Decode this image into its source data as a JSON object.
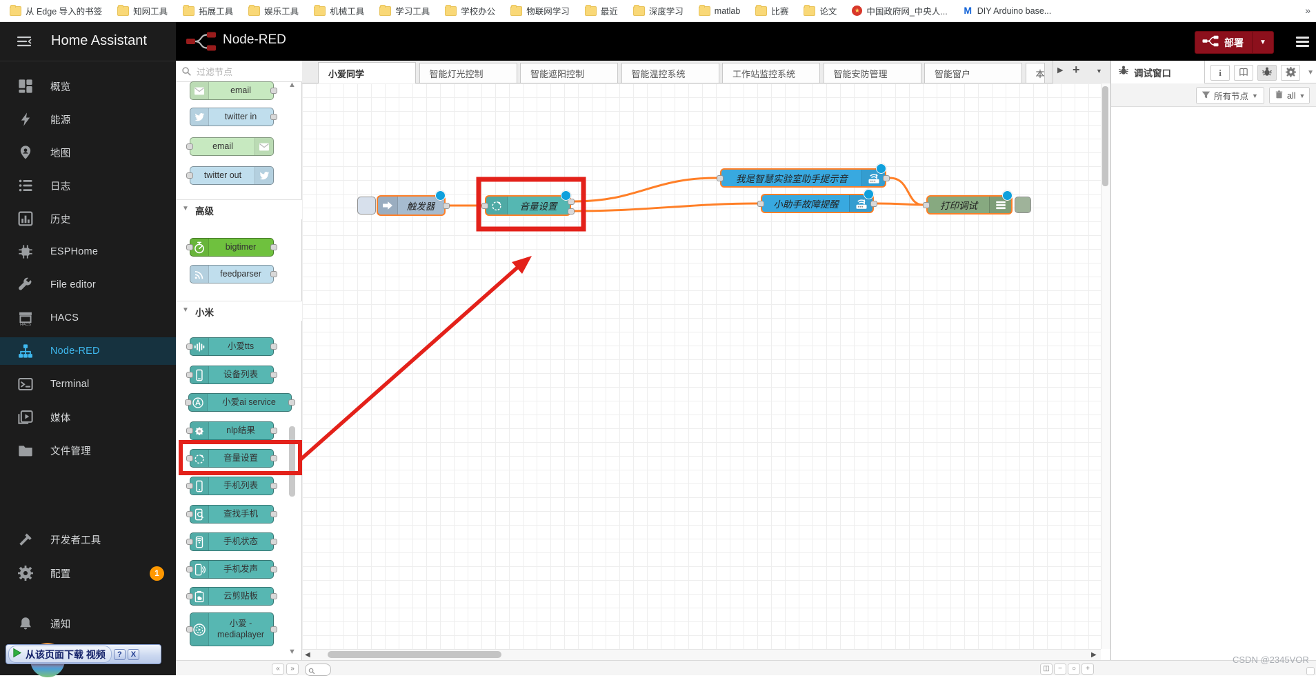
{
  "browser": {
    "bookmarks": [
      {
        "label": "从 Edge 导入的书签",
        "icon": "folder"
      },
      {
        "label": "知网工具",
        "icon": "folder"
      },
      {
        "label": "拓展工具",
        "icon": "folder"
      },
      {
        "label": "娱乐工具",
        "icon": "folder"
      },
      {
        "label": "机械工具",
        "icon": "folder"
      },
      {
        "label": "学习工具",
        "icon": "folder"
      },
      {
        "label": "学校办公",
        "icon": "folder"
      },
      {
        "label": "物联网学习",
        "icon": "folder"
      },
      {
        "label": "最近",
        "icon": "folder"
      },
      {
        "label": "深度学习",
        "icon": "folder"
      },
      {
        "label": "matlab",
        "icon": "folder"
      },
      {
        "label": "比赛",
        "icon": "folder"
      },
      {
        "label": "论文",
        "icon": "folder"
      },
      {
        "label": "中国政府网_中央人...",
        "icon": "gov-emblem"
      },
      {
        "label": "DIY Arduino base...",
        "icon": "m-logo"
      }
    ],
    "overflow_chevron": "»"
  },
  "ha_sidebar": {
    "title": "Home Assistant",
    "items": [
      {
        "label": "概览",
        "icon": "dashboard"
      },
      {
        "label": "能源",
        "icon": "bolt"
      },
      {
        "label": "地图",
        "icon": "person-pin"
      },
      {
        "label": "日志",
        "icon": "logbook-list"
      },
      {
        "label": "历史",
        "icon": "history-chart"
      },
      {
        "label": "ESPHome",
        "icon": "chip"
      },
      {
        "label": "File editor",
        "icon": "wrench"
      },
      {
        "label": "HACS",
        "icon": "hacs-store"
      },
      {
        "label": "Node-RED",
        "icon": "sitemap",
        "active": true
      },
      {
        "label": "Terminal",
        "icon": "terminal"
      },
      {
        "label": "媒体",
        "icon": "media-play"
      },
      {
        "label": "文件管理",
        "icon": "folder"
      }
    ],
    "bottom_items": [
      {
        "label": "开发者工具",
        "icon": "hammer"
      },
      {
        "label": "配置",
        "icon": "gear",
        "badge": "1"
      },
      {
        "label": "通知",
        "icon": "bell"
      }
    ]
  },
  "download_popup": {
    "text": "从该页面下载 视频",
    "help": "?",
    "close": "X"
  },
  "nodered": {
    "title": "Node-RED",
    "deploy_label": "部署",
    "palette": {
      "search_placeholder": "过滤节点",
      "items": [
        {
          "type": "node",
          "label": "email",
          "color": "#c7e9c0",
          "icon": "envelope",
          "icon_side": "left",
          "ports": "out"
        },
        {
          "type": "node",
          "label": "twitter in",
          "color": "#c0deed",
          "icon": "twitter-bird",
          "icon_side": "left",
          "ports": "out"
        },
        {
          "type": "node",
          "label": "email",
          "color": "#c7e9c0",
          "icon": "envelope",
          "icon_side": "right",
          "ports": "in"
        },
        {
          "type": "node",
          "label": "twitter out",
          "color": "#c0deed",
          "icon": "twitter-bird",
          "icon_side": "right",
          "ports": "in"
        },
        {
          "type": "section",
          "label": "高级"
        },
        {
          "type": "node",
          "label": "bigtimer",
          "color": "#6fc13e",
          "icon": "timer",
          "icon_side": "left",
          "ports": "both"
        },
        {
          "type": "node",
          "label": "feedparser",
          "color": "#c0deed",
          "icon": "rss",
          "icon_side": "left",
          "ports": "out"
        },
        {
          "type": "section",
          "label": "小米"
        },
        {
          "type": "node",
          "label": "小爱tts",
          "color": "#57b7b2",
          "icon": "soundbars",
          "icon_side": "left",
          "ports": "both"
        },
        {
          "type": "node",
          "label": "设备列表",
          "color": "#57b7b2",
          "icon": "device-list",
          "icon_side": "left",
          "ports": "both"
        },
        {
          "type": "node",
          "label": "小爱ai service",
          "color": "#57b7b2",
          "icon": "ai-face",
          "icon_side": "left",
          "ports": "both"
        },
        {
          "type": "node",
          "label": "nlp结果",
          "color": "#57b7b2",
          "icon": "brain-badge",
          "icon_side": "left",
          "ports": "both"
        },
        {
          "type": "node",
          "label": "音量设置",
          "color": "#57b7b2",
          "icon": "volume-dial",
          "icon_side": "left",
          "ports": "both",
          "highlighted": true
        },
        {
          "type": "node",
          "label": "手机列表",
          "color": "#57b7b2",
          "icon": "phone",
          "icon_side": "left",
          "ports": "both"
        },
        {
          "type": "node",
          "label": "查找手机",
          "color": "#57b7b2",
          "icon": "phone-find",
          "icon_side": "left",
          "ports": "both"
        },
        {
          "type": "node",
          "label": "手机状态",
          "color": "#57b7b2",
          "icon": "phone-status",
          "icon_side": "left",
          "ports": "both"
        },
        {
          "type": "node",
          "label": "手机发声",
          "color": "#57b7b2",
          "icon": "phone-sound",
          "icon_side": "left",
          "ports": "both"
        },
        {
          "type": "node",
          "label": "云剪贴板",
          "color": "#57b7b2",
          "icon": "cloud-clipboard",
          "icon_side": "left",
          "ports": "both"
        },
        {
          "type": "node",
          "label": "小爱 - mediaplayer",
          "color": "#57b7b2",
          "icon": "mediaplayer",
          "icon_side": "left",
          "ports": "both",
          "tall": true
        }
      ]
    },
    "tabs": {
      "items": [
        {
          "label": "小爱同学",
          "active": true
        },
        {
          "label": "智能灯光控制"
        },
        {
          "label": "智能遮阳控制"
        },
        {
          "label": "智能温控系统"
        },
        {
          "label": "工作站监控系统"
        },
        {
          "label": "智能安防管理"
        },
        {
          "label": "智能窗户"
        },
        {
          "label": "本"
        }
      ]
    },
    "canvas": {
      "nodes": [
        {
          "id": "trigger",
          "label": "触发器",
          "color": "#a6bbcf",
          "icon": "inject-arrow",
          "icon_side": "left"
        },
        {
          "id": "volume",
          "label": "音量设置",
          "color": "#55b7b2",
          "icon": "volume-dial",
          "icon_side": "left"
        },
        {
          "id": "tts-lab",
          "label": "我是智慧实验室助手提示音",
          "color": "#38a9e0",
          "icon": "wifi-router",
          "icon_side": "right"
        },
        {
          "id": "tts-fault",
          "label": "小助手故障提醒",
          "color": "#38a9e0",
          "icon": "wifi-router",
          "icon_side": "right"
        },
        {
          "id": "debug",
          "label": "打印调试",
          "color": "#87a980",
          "icon": "debug-list",
          "icon_side": "right"
        }
      ]
    },
    "debug": {
      "tab": "调试窗口",
      "filter_label": "所有节点",
      "clear_label": "all"
    }
  },
  "footer": {
    "buttons": [
      "◫",
      "−",
      "○",
      "+"
    ],
    "collapse_left": "«",
    "collapse_right": "»"
  },
  "watermark": "CSDN @2345VOR"
}
